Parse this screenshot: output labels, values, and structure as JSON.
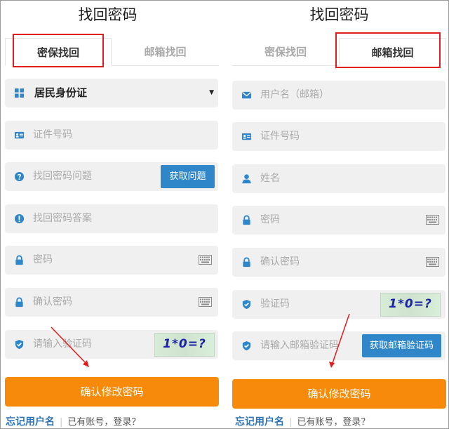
{
  "left": {
    "title": "找回密码",
    "tabs": {
      "security": "密保找回",
      "email": "邮箱找回"
    },
    "id_type": {
      "value": "居民身份证"
    },
    "fields": {
      "id_number": "证件号码",
      "security_question": "找回密码问题",
      "security_answer": "找回密码答案",
      "password": "密码",
      "confirm_password": "确认密码",
      "captcha": "请输入验证码"
    },
    "get_question_button": "获取问题",
    "captcha_text": "1*0=?",
    "submit": "确认修改密码",
    "footer": {
      "forgot": "忘记用户名",
      "login": "已有账号，登录？"
    }
  },
  "right": {
    "title": "找回密码",
    "tabs": {
      "security": "密保找回",
      "email": "邮箱找回"
    },
    "fields": {
      "username": "用户名（邮箱）",
      "id_number": "证件号码",
      "name": "姓名",
      "password": "密码",
      "confirm_password": "确认密码",
      "captcha": "验证码",
      "email_code": "请输入邮箱验证码"
    },
    "captcha_text": "1*0=?",
    "get_email_code_button": "获取邮箱验证码",
    "submit": "确认修改密码",
    "footer": {
      "forgot": "忘记用户名",
      "login": "已有账号，登录？"
    }
  },
  "colors": {
    "accent_orange": "#f78a0a",
    "button_blue": "#2f86c8",
    "highlight_red": "#e01e1e",
    "icon_blue": "#2f86c8"
  }
}
